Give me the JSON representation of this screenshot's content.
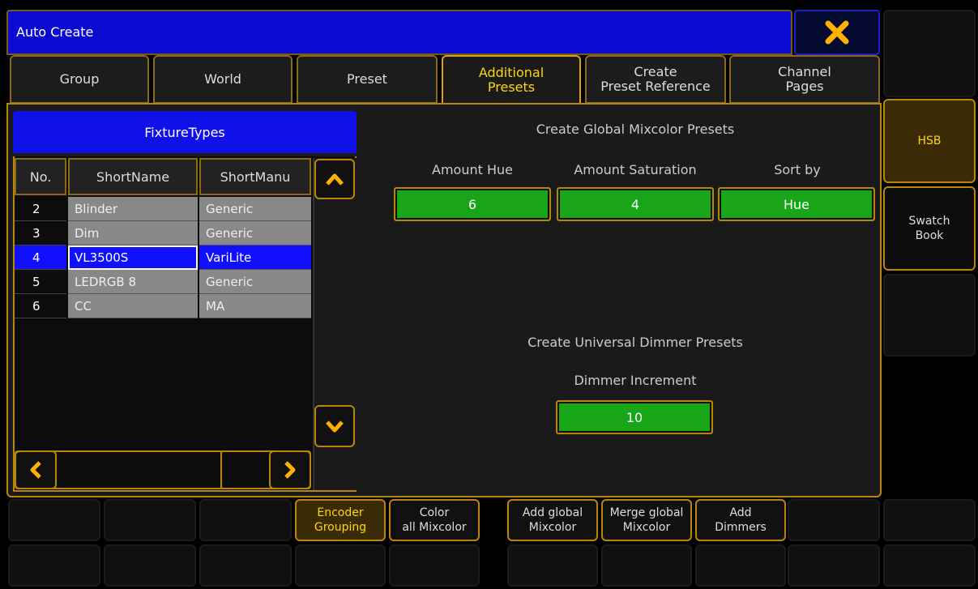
{
  "window": {
    "title": "Auto Create"
  },
  "tabs": [
    {
      "label": "Group"
    },
    {
      "label": "World"
    },
    {
      "label": "Preset"
    },
    {
      "label_line1": "Additional",
      "label_line2": "Presets",
      "active": true
    },
    {
      "label_line1": "Create",
      "label_line2": "Preset Reference"
    },
    {
      "label_line1": "Channel",
      "label_line2": "Pages"
    }
  ],
  "fixture_types": {
    "header": "FixtureTypes",
    "columns": [
      "No.",
      "ShortName",
      "ShortManu"
    ],
    "rows": [
      {
        "no": "2",
        "name": "Blinder",
        "manu": "Generic"
      },
      {
        "no": "3",
        "name": "Dim",
        "manu": "Generic"
      },
      {
        "no": "4",
        "name": "VL3500S",
        "manu": "VariLite",
        "selected": true
      },
      {
        "no": "5",
        "name": "LEDRGB 8",
        "manu": "Generic"
      },
      {
        "no": "6",
        "name": "CC",
        "manu": "MA"
      }
    ]
  },
  "mixcolor": {
    "title": "Create Global Mixcolor Presets",
    "hue_label": "Amount Hue",
    "hue_value": "6",
    "sat_label": "Amount Saturation",
    "sat_value": "4",
    "sort_label": "Sort by",
    "sort_value": "Hue"
  },
  "dimmer": {
    "title": "Create Universal Dimmer Presets",
    "increment_label": "Dimmer Increment",
    "increment_value": "10"
  },
  "side_buttons": [
    {
      "label": "HSB"
    },
    {
      "label_line1": "Swatch",
      "label_line2": "Book"
    }
  ],
  "bottom_buttons": [
    {
      "line1": "Encoder",
      "line2": "Grouping"
    },
    {
      "line1": "Color",
      "line2": "all Mixcolor"
    },
    {
      "line1": "Add global",
      "line2": "Mixcolor"
    },
    {
      "line1": "Merge global",
      "line2": "Mixcolor"
    },
    {
      "line1": "Add",
      "line2": "Dimmers"
    }
  ],
  "colors": {
    "title_blue": "#0a0ad0",
    "frame_gold": "#b8860b",
    "active_yellow": "#ffd800",
    "value_green": "#18a518",
    "selected_row": "#1010ff"
  },
  "icons": [
    "close-icon",
    "scroll-up-icon",
    "scroll-down-icon",
    "scroll-left-icon",
    "scroll-right-icon"
  ]
}
